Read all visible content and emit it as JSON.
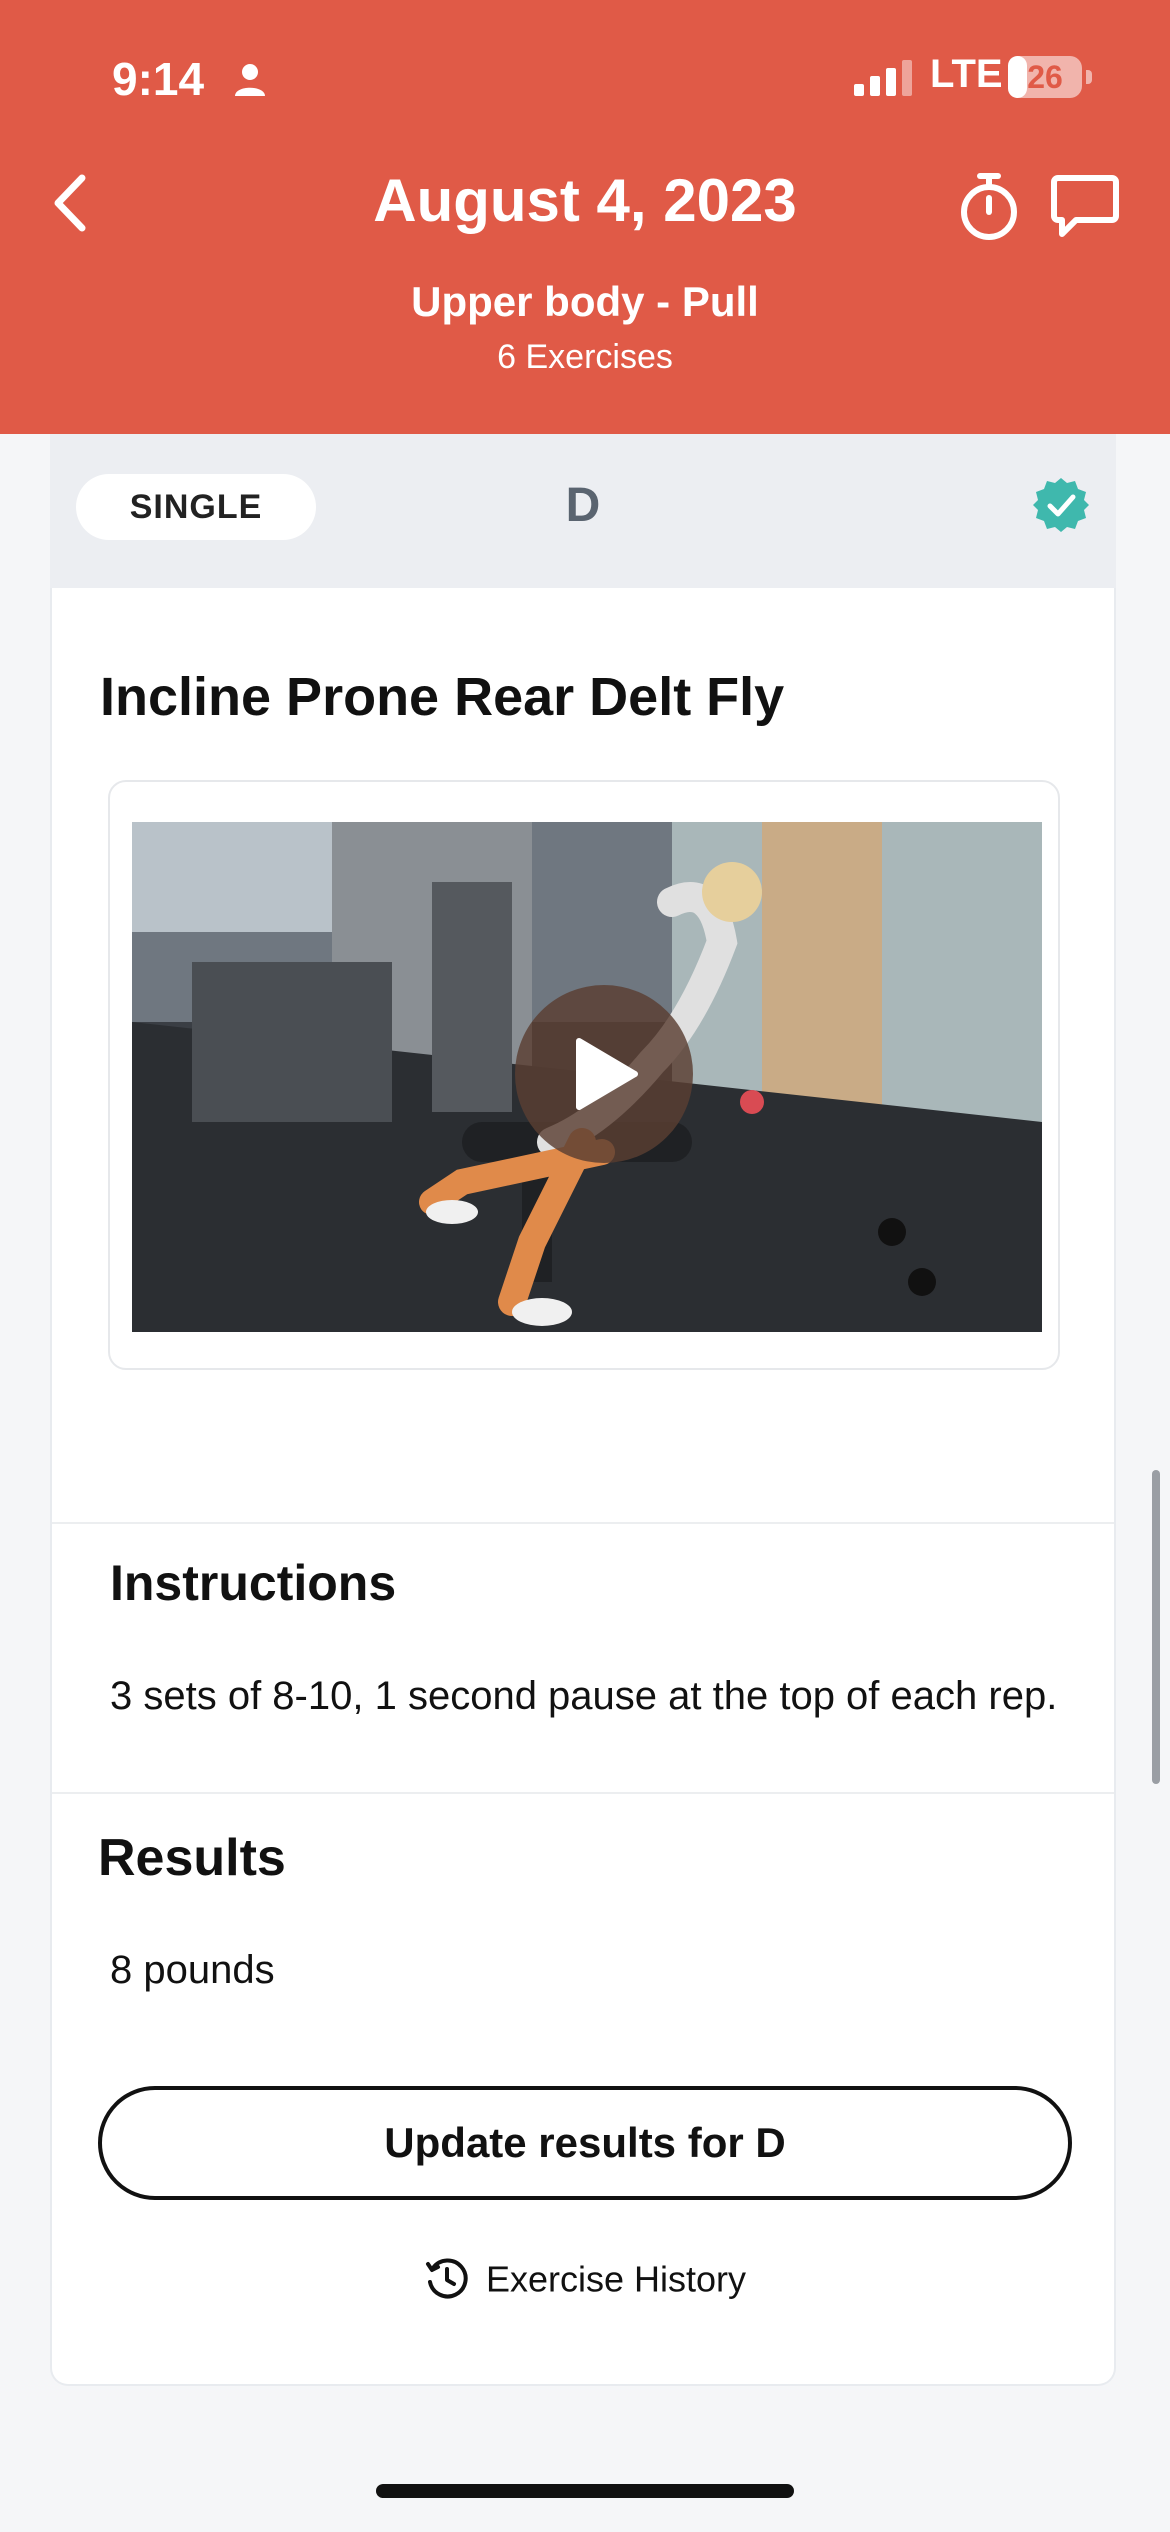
{
  "status_bar": {
    "time": "9:14",
    "network": "LTE",
    "battery_level": "26",
    "battery_fraction": 0.26,
    "icons": [
      "person-icon",
      "signal-icon",
      "battery-icon"
    ]
  },
  "header": {
    "date": "August 4, 2023",
    "workout_name": "Upper body - Pull",
    "exercise_count": "6 Exercises",
    "background_color": "#e05a47",
    "icons": [
      "back-chevron-icon",
      "stopwatch-icon",
      "chat-bubble-icon"
    ]
  },
  "group": {
    "type_label": "SINGLE",
    "letter": "D",
    "completed": true,
    "check_color": "#3fb8ad"
  },
  "exercise": {
    "name": "Incline Prone Rear Delt Fly",
    "video": {
      "icon": "play-icon"
    },
    "instructions_heading": "Instructions",
    "instructions_text": "3 sets of 8-10, 1 second pause at the top of each rep.",
    "results_heading": "Results",
    "results_value": "8 pounds",
    "update_button_label": "Update results for D",
    "history_label": "Exercise History",
    "history_icon": "history-clock-icon"
  }
}
